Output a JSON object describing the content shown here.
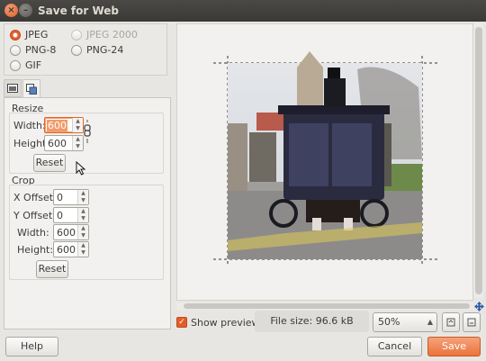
{
  "window": {
    "title": "Save for Web"
  },
  "formats": [
    {
      "label": "JPEG",
      "selected": true,
      "enabled": true
    },
    {
      "label": "JPEG 2000",
      "selected": false,
      "enabled": false
    },
    {
      "label": "PNG-8",
      "selected": false,
      "enabled": true
    },
    {
      "label": "PNG-24",
      "selected": false,
      "enabled": true
    },
    {
      "label": "GIF",
      "selected": false,
      "enabled": true
    }
  ],
  "resize": {
    "title": "Resize",
    "width_label": "Width:",
    "width_value": "600",
    "height_label": "Height:",
    "height_value": "600",
    "reset_label": "Reset"
  },
  "crop": {
    "title": "Crop",
    "x_offset_label": "X Offset:",
    "x_offset_value": "0",
    "y_offset_label": "Y Offset:",
    "y_offset_value": "0",
    "width_label": "Width:",
    "width_value": "600",
    "height_label": "Height:",
    "height_value": "600",
    "reset_label": "Reset"
  },
  "preview": {
    "show_preview_label": "Show preview",
    "show_preview_checked": true,
    "file_size": "File size: 96.6 kB",
    "zoom": "50%"
  },
  "buttons": {
    "help": "Help",
    "cancel": "Cancel",
    "save": "Save"
  },
  "colors": {
    "accent": "#e35e2b",
    "titlebar": "#3c3b37"
  }
}
